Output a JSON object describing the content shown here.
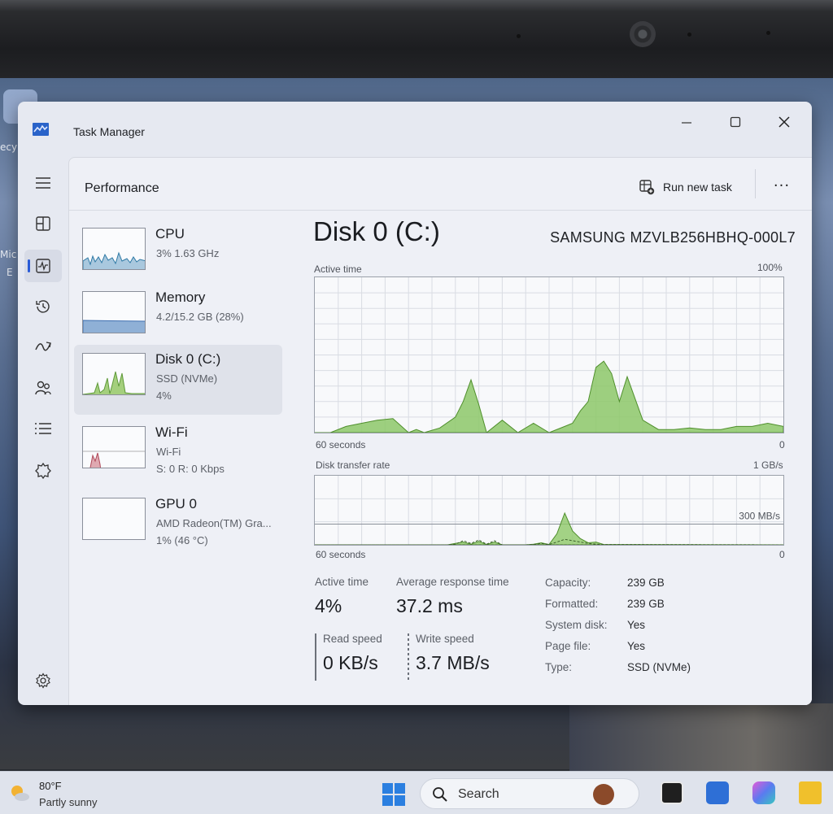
{
  "desktop": {
    "left_label_1": "ecy",
    "left_label_2": "Mic",
    "left_label_3": "E"
  },
  "window": {
    "title": "Task Manager",
    "controls": {
      "minimize": "minimize",
      "maximize": "maximize",
      "close": "close"
    }
  },
  "nav": {
    "items": [
      "menu",
      "processes",
      "performance",
      "app-history",
      "startup-apps",
      "users",
      "details",
      "services"
    ],
    "active": "performance",
    "settings": "settings"
  },
  "header": {
    "title": "Performance",
    "run_new_task": "Run new task",
    "more": "···"
  },
  "devices": [
    {
      "name": "CPU",
      "line2": "3%  1.63 GHz",
      "line3": ""
    },
    {
      "name": "Memory",
      "line2": "4.2/15.2 GB (28%)",
      "line3": ""
    },
    {
      "name": "Disk 0 (C:)",
      "line2": "SSD (NVMe)",
      "line3": "4%"
    },
    {
      "name": "Wi-Fi",
      "line2": "Wi-Fi",
      "line3": "S: 0  R: 0 Kbps"
    },
    {
      "name": "GPU 0",
      "line2": "AMD Radeon(TM) Gra...",
      "line3": "1%  (46 °C)"
    }
  ],
  "detail": {
    "title": "Disk 0 (C:)",
    "model": "SAMSUNG MZVLB256HBHQ-000L7",
    "active_graph": {
      "label": "Active time",
      "max_label": "100%",
      "time_label": "60 seconds",
      "min_label": "0"
    },
    "transfer_graph": {
      "label": "Disk transfer rate",
      "max_label": "1 GB/s",
      "ref_label": "300 MB/s",
      "time_label": "60 seconds",
      "min_label": "0"
    },
    "stats": {
      "active_time_label": "Active time",
      "active_time_value": "4%",
      "avg_response_label": "Average response time",
      "avg_response_value": "37.2 ms",
      "read_label": "Read speed",
      "read_value": "0 KB/s",
      "write_label": "Write speed",
      "write_value": "3.7 MB/s"
    },
    "properties": [
      {
        "key": "Capacity:",
        "value": "239 GB"
      },
      {
        "key": "Formatted:",
        "value": "239 GB"
      },
      {
        "key": "System disk:",
        "value": "Yes"
      },
      {
        "key": "Page file:",
        "value": "Yes"
      },
      {
        "key": "Type:",
        "value": "SSD (NVMe)"
      }
    ]
  },
  "chart_data": [
    {
      "type": "area",
      "title": "Active time",
      "xlabel": "60 seconds",
      "ylabel": "",
      "ylim": [
        0,
        100
      ],
      "x": [
        0,
        2,
        4,
        6,
        8,
        10,
        12,
        13,
        14,
        16,
        18,
        19,
        20,
        21,
        22,
        24,
        26,
        28,
        30,
        32,
        33,
        34,
        35,
        36,
        37,
        38,
        39,
        40,
        42,
        44,
        46,
        48,
        50,
        52,
        54,
        56,
        58,
        60
      ],
      "y": [
        0,
        0,
        4,
        6,
        8,
        9,
        0,
        2,
        0,
        3,
        10,
        20,
        34,
        18,
        0,
        8,
        0,
        6,
        0,
        4,
        6,
        14,
        20,
        42,
        46,
        38,
        20,
        36,
        8,
        2,
        2,
        3,
        2,
        2,
        4,
        4,
        6,
        4
      ],
      "color": "#8dc868"
    },
    {
      "type": "line",
      "title": "Disk transfer rate",
      "xlabel": "60 seconds",
      "ylabel": "",
      "ylim": [
        0,
        1000
      ],
      "reference_line": 300,
      "x": [
        0,
        10,
        17,
        18,
        19,
        20,
        21,
        22,
        23,
        24,
        27,
        28,
        29,
        30,
        31,
        32,
        33,
        34,
        35,
        36,
        37,
        60
      ],
      "series": [
        {
          "name": "Read speed",
          "values": [
            0,
            0,
            0,
            20,
            40,
            10,
            50,
            5,
            40,
            0,
            0,
            10,
            30,
            5,
            160,
            460,
            200,
            90,
            30,
            40,
            5,
            0
          ]
        },
        {
          "name": "Write speed",
          "values": [
            0,
            0,
            0,
            10,
            60,
            20,
            70,
            10,
            60,
            0,
            0,
            5,
            20,
            5,
            40,
            80,
            60,
            40,
            20,
            10,
            5,
            0
          ]
        }
      ]
    }
  ],
  "taskbar": {
    "weather_temp": "80°F",
    "weather_cond": "Partly sunny",
    "search_label": "Search"
  }
}
